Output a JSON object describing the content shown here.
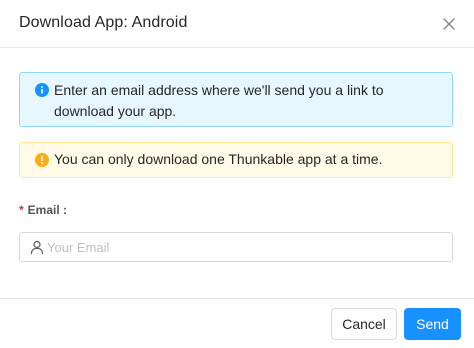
{
  "dialog": {
    "title": "Download App: Android",
    "close_label": "close"
  },
  "alerts": {
    "info": {
      "text": "Enter an email address where we'll send you a link to download your app.",
      "icon": "info-circle-icon",
      "color": "#1890ff"
    },
    "warning": {
      "text": "You can only download one Thunkable app at a time.",
      "icon": "exclamation-circle-icon",
      "color": "#faad14"
    }
  },
  "form": {
    "email": {
      "required_mark": "*",
      "label": "Email :",
      "placeholder": "Your Email",
      "value": "",
      "icon": "user-icon"
    }
  },
  "footer": {
    "cancel_label": "Cancel",
    "send_label": "Send"
  },
  "colors": {
    "primary": "#1890ff",
    "required": "#f5222d"
  }
}
